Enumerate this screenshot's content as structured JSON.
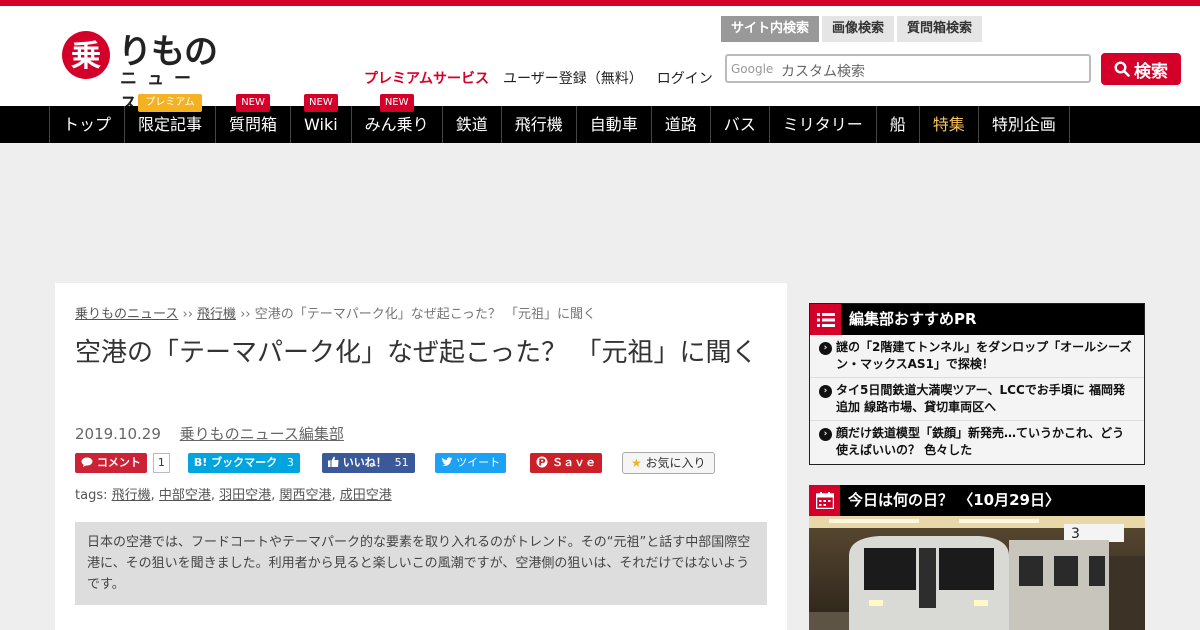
{
  "site": {
    "logo_text": "りもの",
    "logo_kanji": "乗",
    "logo_sub": "ニュース"
  },
  "header_links": {
    "premium": "プレミアムサービス",
    "register": "ユーザー登録（無料）",
    "login": "ログイン"
  },
  "search": {
    "tabs": [
      "サイト内検索",
      "画像検索",
      "質問箱検索"
    ],
    "google_label": "Google",
    "placeholder": "カスタム検索",
    "button": "検索"
  },
  "nav": [
    {
      "label": "トップ",
      "badge": ""
    },
    {
      "label": "限定記事",
      "badge": "プレミアム"
    },
    {
      "label": "質問箱",
      "badge": "NEW"
    },
    {
      "label": "Wiki",
      "badge": "NEW"
    },
    {
      "label": "みん乗り",
      "badge": "NEW"
    },
    {
      "label": "鉄道",
      "badge": ""
    },
    {
      "label": "飛行機",
      "badge": ""
    },
    {
      "label": "自動車",
      "badge": ""
    },
    {
      "label": "道路",
      "badge": ""
    },
    {
      "label": "バス",
      "badge": ""
    },
    {
      "label": "ミリタリー",
      "badge": ""
    },
    {
      "label": "船",
      "badge": ""
    },
    {
      "label": "特集",
      "badge": ""
    },
    {
      "label": "特別企画",
      "badge": ""
    }
  ],
  "breadcrumb": {
    "home": "乗りものニュース",
    "sep": "››",
    "category": "飛行機",
    "current": "空港の「テーマパーク化」なぜ起こった？ 「元祖」に聞く"
  },
  "article": {
    "title": "空港の「テーマパーク化」なぜ起こった？ 「元祖」に聞く",
    "date": "2019.10.29",
    "author": "乗りものニュース編集部",
    "tags_label": "tags:",
    "tags": [
      "飛行機",
      "中部空港",
      "羽田空港",
      "関西空港",
      "成田空港"
    ],
    "lead": "日本の空港では、フードコートやテーマパーク的な要素を取り入れるのがトレンド。その“元祖”と話す中部国際空港に、その狙いを聞きました。利用者から見ると楽しいこの風潮ですが、空港側の狙いは、それだけではないようです。"
  },
  "social": {
    "comment": "コメント",
    "comment_count": "1",
    "hatena": "B! ブックマーク",
    "hatena_count": "3",
    "like": "いいね！",
    "like_count": "51",
    "tweet": "ツイート",
    "pin": "Ｓａｖｅ",
    "fav": "お気に入り"
  },
  "sidebar": {
    "pr_title": "編集部おすすめPR",
    "pr_items": [
      "謎の「2階建てトンネル」をダンロップ「オールシーズン・マックスAS1」で探検！",
      "タイ5日間鉄道大満喫ツアー、LCCでお手頃に 福岡発追加 線路市場、貸切車両区へ",
      "顔だけ鉄道模型「鉄顔」新発売…ていうかこれ、どう使えばいいの？ 色々した"
    ],
    "today_title": "今日は何の日？ 〈10月29日〉",
    "photo_number": "3"
  },
  "colors": {
    "brand_red": "#d4002a",
    "nav_bg": "#000000",
    "feature_gold": "#f6c15a",
    "hatena_blue": "#00a4de",
    "fb_blue": "#3b5998",
    "tw_blue": "#1da1f2",
    "pin_red": "#cb2027"
  }
}
